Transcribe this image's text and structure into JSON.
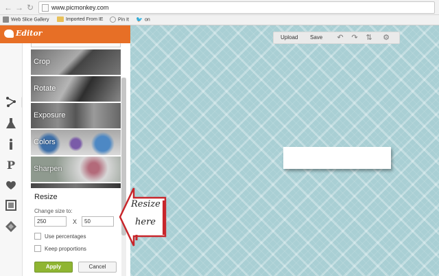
{
  "browser": {
    "url": "www.picmonkey.com",
    "bookmarks": [
      {
        "label": "Web Slice Gallery",
        "icon": "web-slice-icon"
      },
      {
        "label": "Imported From IE",
        "icon": "folder-icon"
      },
      {
        "label": "Pin It",
        "icon": "pin-icon"
      },
      {
        "label": "on",
        "icon": "twitter-icon"
      }
    ]
  },
  "app": {
    "logo_text": "Editor",
    "brand_color": "#e76f26"
  },
  "rail": {
    "items": [
      {
        "name": "basic-edits-icon",
        "glyph": "⚬"
      },
      {
        "name": "effects-icon",
        "glyph": "⚗"
      },
      {
        "name": "touch-up-icon",
        "glyph": "ℹ"
      },
      {
        "name": "text-icon",
        "glyph": "P"
      },
      {
        "name": "overlays-icon",
        "glyph": "♥"
      },
      {
        "name": "frames-icon",
        "glyph": "▣"
      },
      {
        "name": "textures-icon",
        "glyph": "❖"
      }
    ]
  },
  "tools": {
    "crop": "Crop",
    "rotate": "Rotate",
    "exposure": "Exposure",
    "colors": "Colors",
    "sharpen": "Sharpen"
  },
  "resize": {
    "title": "Resize",
    "change_label": "Change size to:",
    "width": "250",
    "separator": "X",
    "height": "50",
    "use_percentages": "Use percentages",
    "keep_proportions": "Keep proportions",
    "apply": "Apply",
    "cancel": "Cancel"
  },
  "toolbar": {
    "upload": "Upload",
    "save": "Save",
    "icons": [
      "undo-icon",
      "redo-icon",
      "compare-icon",
      "settings-icon"
    ]
  },
  "annotation": {
    "line1": "Resize",
    "line2": "here"
  },
  "colors": {
    "canvas": "#a9cfd4",
    "apply_button": "#8fb532",
    "annotation_arrow": "#c8262b"
  }
}
